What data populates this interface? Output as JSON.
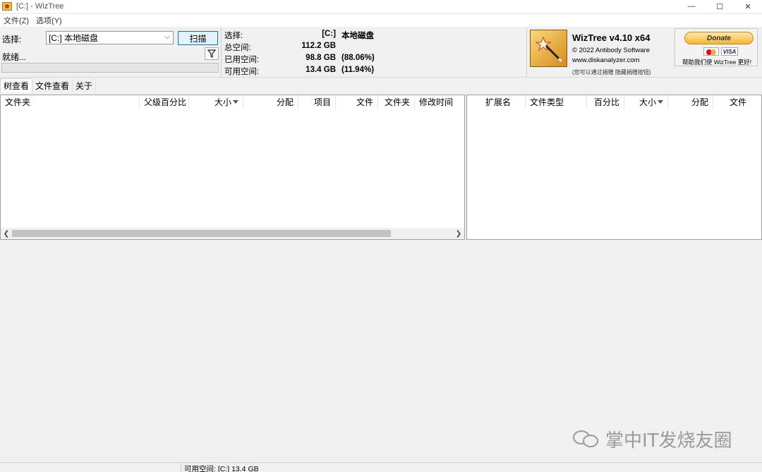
{
  "window": {
    "title": "[C:]  - WizTree",
    "minimize": "—",
    "maximize": "☐",
    "close": "✕"
  },
  "menu": [
    "文件(Z)",
    "选项(Y)"
  ],
  "toolbar": {
    "select_label": "选择:",
    "drive_value": "[C:] 本地磁盘",
    "scan_label": "扫描",
    "status_label": "就绪...",
    "progress_percent": 0
  },
  "drive_info": {
    "rows": [
      {
        "label": "选择:",
        "value": "[C:]",
        "extra": "本地磁盘"
      },
      {
        "label": "总空间:",
        "value": "112.2 GB",
        "extra": ""
      },
      {
        "label": "已用空间:",
        "value": "98.8 GB",
        "extra": "(88.06%)"
      },
      {
        "label": "可用空间:",
        "value": "13.4 GB",
        "extra": "(11.94%)"
      }
    ]
  },
  "about": {
    "title": "WizTree v4.10 x64",
    "copyright": "© 2022 Antibody Software",
    "url": "www.diskanalyzer.com",
    "note": "(您可以通过捐赠 隐藏捐赠按钮)"
  },
  "donate": {
    "button": "Donate",
    "card_visa": "VISA",
    "help": "帮助我们使 WizTree 更好!"
  },
  "tabs": [
    "树查看",
    "文件查看",
    "关于"
  ],
  "tree_columns": [
    "文件夹",
    "父级百分比",
    "大小",
    "分配",
    "项目",
    "文件",
    "文件夹",
    "修改时间"
  ],
  "ext_columns": [
    "扩展名",
    "文件类型",
    "百分比",
    "大小",
    "分配",
    "文件"
  ],
  "status_bar": "可用空间: [C:] 13.4 GB",
  "watermark": "掌中IT发烧友圈",
  "colors": {
    "accent": "#0078d7",
    "progress": "#06b025",
    "donate": "#f7b534"
  }
}
